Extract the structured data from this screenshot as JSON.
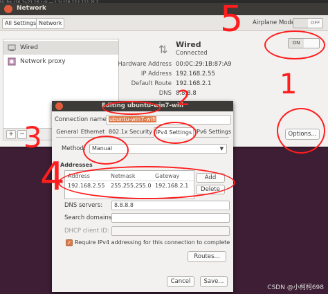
{
  "topstrip": "tic  for r16 1r-21 16 r  rk  ---   t  1r t16  12  t   111  2t  2",
  "network": {
    "title": "Network",
    "toolbar": {
      "all_settings": "All Settings",
      "network": "Network"
    },
    "airplane_mode": {
      "label": "Airplane Mode",
      "on": "",
      "off": "OFF"
    },
    "sidebar": [
      {
        "label": "Wired",
        "icon": "ethernet-icon"
      },
      {
        "label": "Network proxy",
        "icon": "proxy-icon"
      }
    ],
    "sidebar_add": "+",
    "sidebar_remove": "−",
    "wired": {
      "title": "Wired",
      "status": "Connected",
      "switch_on": "ON",
      "details": [
        {
          "label": "Hardware Address",
          "value": "00:0C:29:1B:87:A9"
        },
        {
          "label": "IP Address",
          "value": "192.168.2.55"
        },
        {
          "label": "Default Route",
          "value": "192.168.2.1"
        },
        {
          "label": "DNS",
          "value": "8.8.8.8"
        }
      ],
      "options_button": "Options..."
    }
  },
  "dialog": {
    "title": "Editing ubuntu-win7-wifi",
    "connection_name_label": "Connection name:",
    "connection_name_value": "ubuntu-win7-wifi",
    "tabs": [
      "General",
      "Ethernet",
      "802.1x Security",
      "IPv4 Settings",
      "IPv6 Settings"
    ],
    "active_tab": "IPv4 Settings",
    "method_label": "Method:",
    "method_value": "Manual",
    "addresses_label": "Addresses",
    "address_columns": [
      "Address",
      "Netmask",
      "Gateway"
    ],
    "address_rows": [
      {
        "address": "192.168.2.55",
        "netmask": "255.255.255.0",
        "gateway": "192.168.2.1"
      }
    ],
    "add_button": "Add",
    "delete_button": "Delete",
    "dns_label": "DNS servers:",
    "dns_value": "8.8.8.8",
    "search_label": "Search domains:",
    "search_value": "",
    "dhcp_label": "DHCP client ID:",
    "dhcp_value": "",
    "require_ipv4_label": "Require IPv4 addressing for this connection to complete",
    "require_ipv4_checked": true,
    "routes_button": "Routes...",
    "cancel_button": "Cancel",
    "save_button": "Save..."
  },
  "annotations": {
    "n1": "1",
    "n2": "2",
    "n3": "3",
    "n4": "4",
    "n5": "5"
  },
  "watermark": "CSDN @小柯柯698",
  "colors": {
    "annotation": "#ff1d1d",
    "titlebar": "#3c3b37",
    "close": "#e05b3c",
    "desktop": "#3d1e34"
  }
}
